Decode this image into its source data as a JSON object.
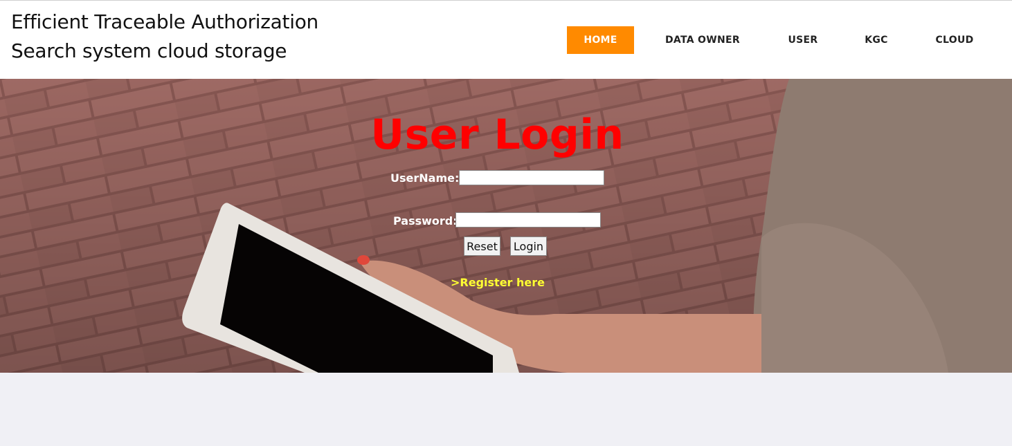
{
  "header": {
    "title_line1": "Efficient Traceable Authorization",
    "title_line2": "Search system cloud storage"
  },
  "nav": {
    "items": [
      {
        "label": "HOME",
        "active": true
      },
      {
        "label": "DATA OWNER",
        "active": false
      },
      {
        "label": "USER",
        "active": false
      },
      {
        "label": "KGC",
        "active": false
      },
      {
        "label": "CLOUD",
        "active": false
      }
    ]
  },
  "login": {
    "title": "User Login",
    "username_label": "UserName:",
    "username_value": "",
    "password_label": "Password:",
    "password_value": "",
    "reset_label": "Reset",
    "login_label": "Login",
    "register_link": ">Register here"
  },
  "colors": {
    "accent": "#ff8a00",
    "title_red": "#ff0000",
    "register_yellow": "#ffff33"
  }
}
